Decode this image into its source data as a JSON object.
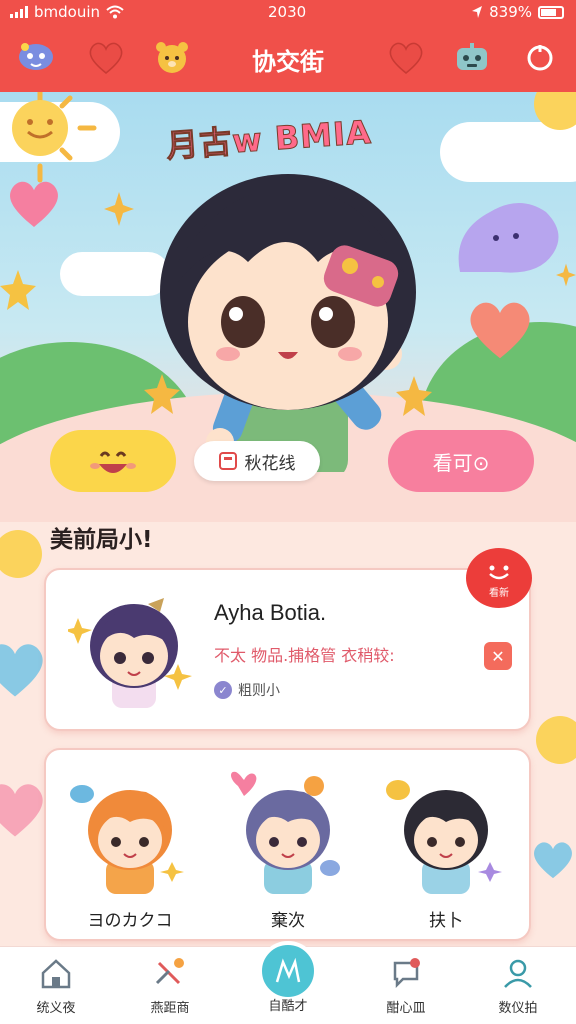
{
  "status_bar": {
    "carrier": "bmdouin",
    "time": "2030",
    "battery": "839%"
  },
  "header": {
    "title": "协交街"
  },
  "hero": {
    "title": "月古w BMIA"
  },
  "hero_actions": {
    "center_label": "秋花线",
    "right_label": "看可⊙"
  },
  "section": {
    "title": "美前局小!"
  },
  "profile_card": {
    "name": "Ayha Botia.",
    "tags": "不太 物品.捕格管 衣稍较:",
    "meta": "粗则小",
    "badge": "看新"
  },
  "friends": [
    {
      "label": "ヨのカクコ"
    },
    {
      "label": "棄次"
    },
    {
      "label": "扶卜"
    }
  ],
  "nav": [
    {
      "label": "统义夜",
      "icon": "home-icon"
    },
    {
      "label": "燕距商",
      "icon": "tools-icon"
    },
    {
      "label": "自酷才",
      "icon": "create-icon"
    },
    {
      "label": "酣心皿",
      "icon": "chat-icon"
    },
    {
      "label": "数仪拍",
      "icon": "profile-icon"
    }
  ],
  "colors": {
    "brand": "#f0504a",
    "accent_pink": "#f77f9e",
    "accent_yellow": "#fbd64a",
    "accent_teal": "#4ec4d4"
  }
}
